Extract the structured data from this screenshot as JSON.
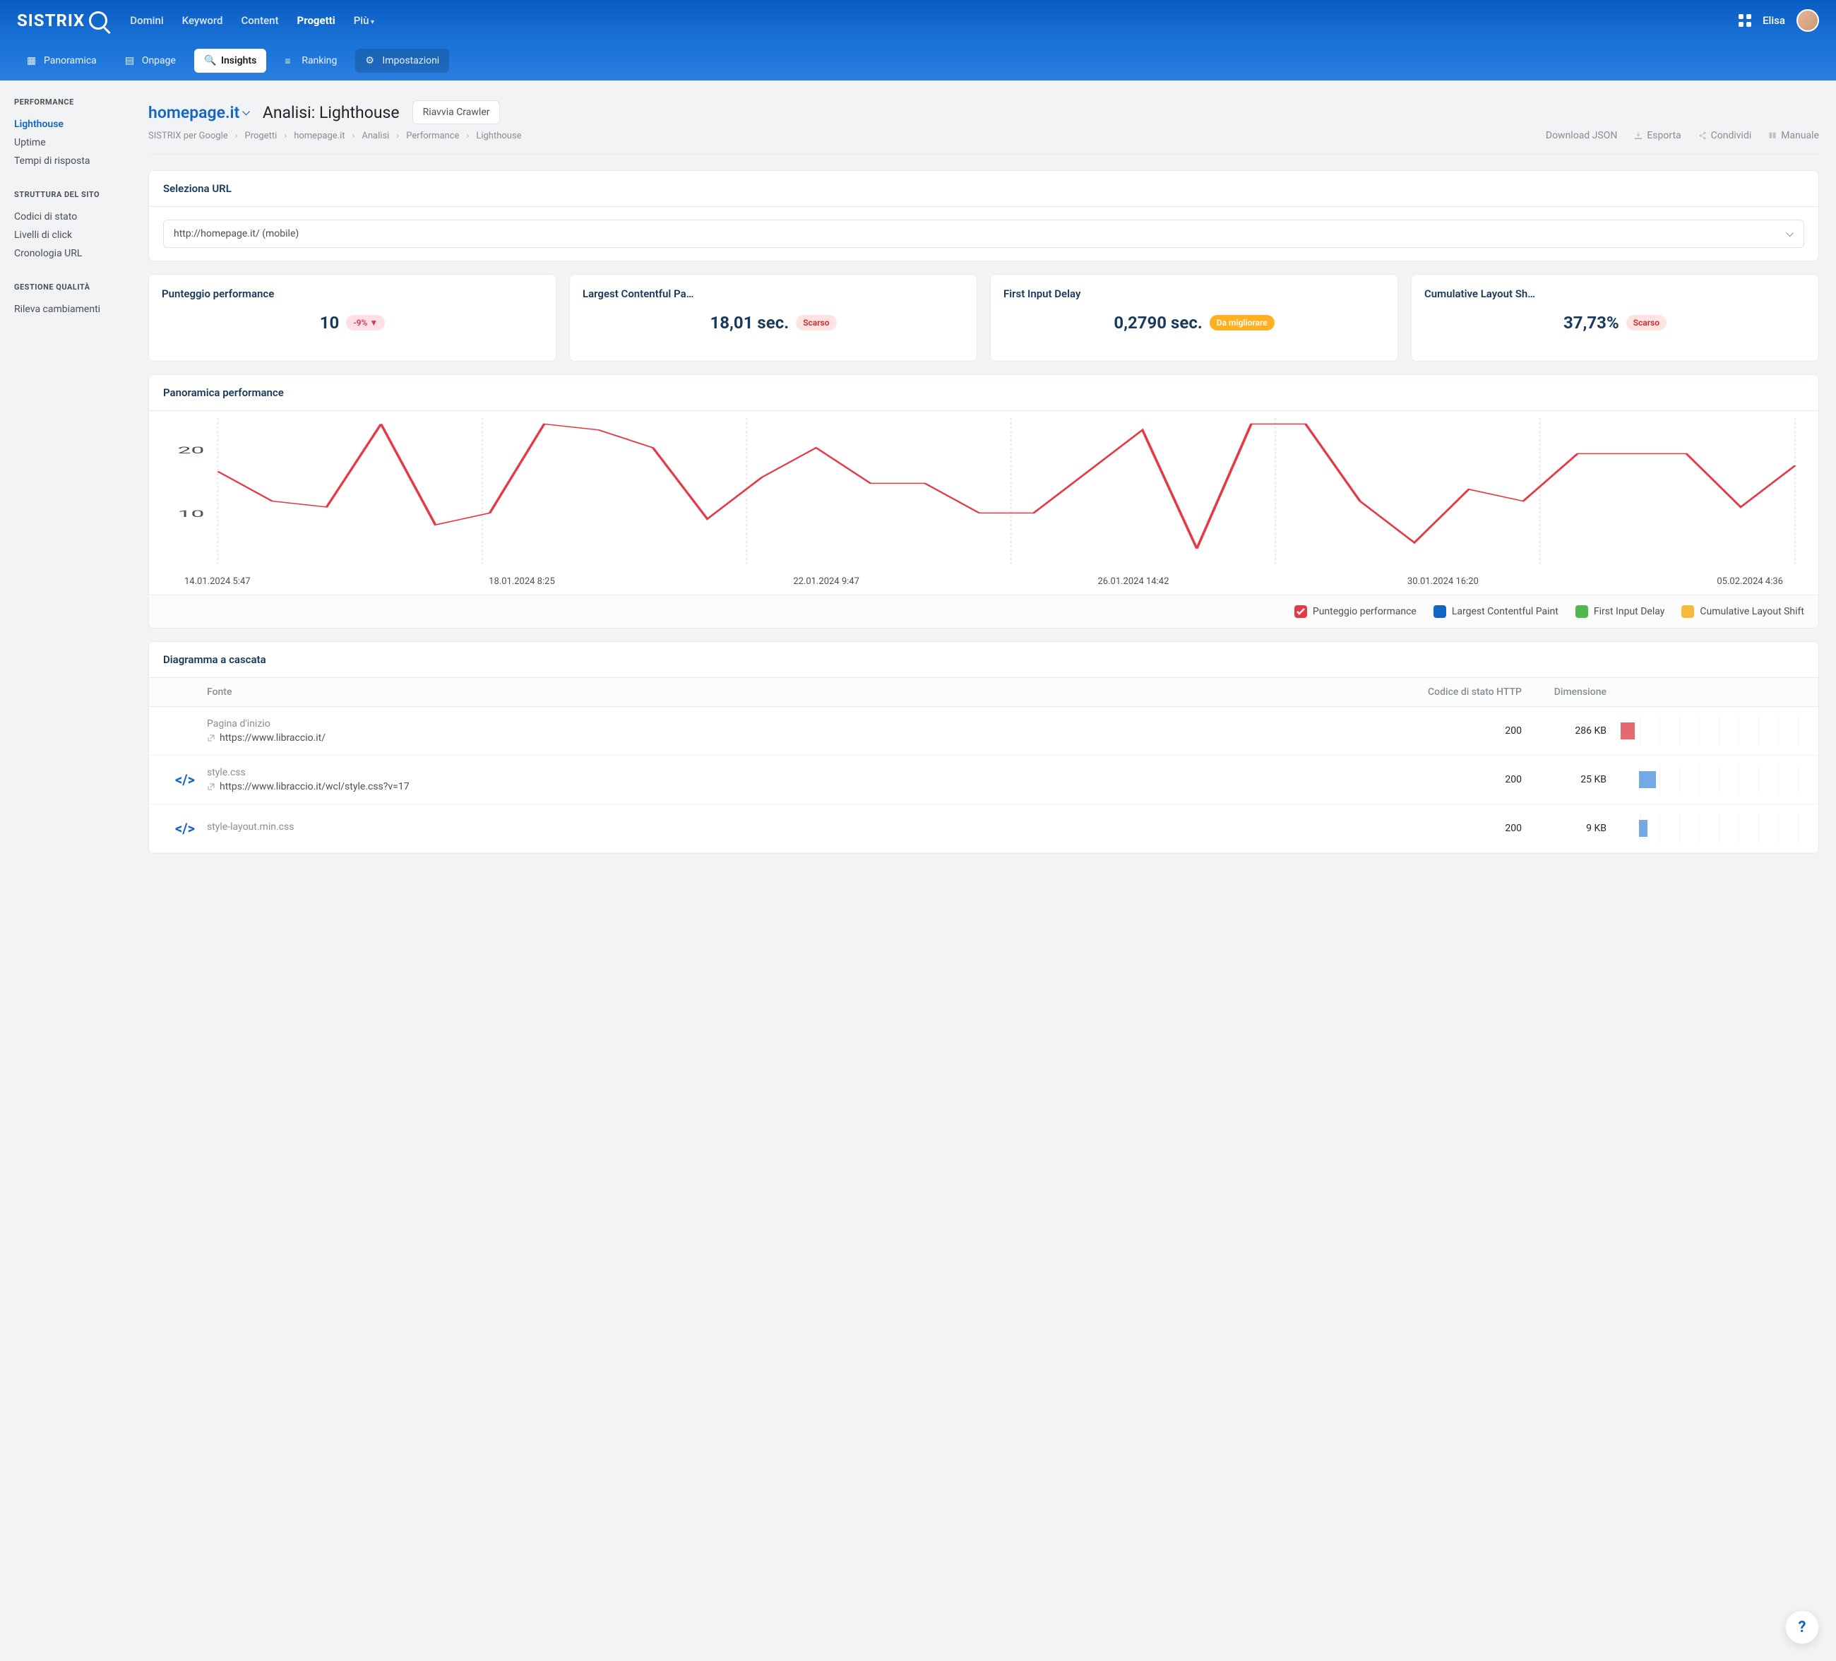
{
  "brand": "SISTRIX",
  "topnav": {
    "links": [
      "Domini",
      "Keyword",
      "Content",
      "Progetti",
      "Più"
    ],
    "active": 3,
    "user": "Elisa"
  },
  "subnav": {
    "items": [
      {
        "label": "Panoramica"
      },
      {
        "label": "Onpage"
      },
      {
        "label": "Insights"
      },
      {
        "label": "Ranking"
      },
      {
        "label": "Impostazioni"
      }
    ],
    "active": 2
  },
  "sidebar": {
    "sections": [
      {
        "heading": "PERFORMANCE",
        "links": [
          "Lighthouse",
          "Uptime",
          "Tempi di risposta"
        ],
        "active": 0
      },
      {
        "heading": "STRUTTURA DEL SITO",
        "links": [
          "Codici di stato",
          "Livelli di click",
          "Cronologia URL"
        ]
      },
      {
        "heading": "GESTIONE QUALITÀ",
        "links": [
          "Rileva cambiamenti"
        ]
      }
    ]
  },
  "header": {
    "domain": "homepage.it",
    "title": "Analisi: Lighthouse",
    "action": "Riavvia Crawler"
  },
  "breadcrumb": [
    "SISTRIX per Google",
    "Progetti",
    "homepage.it",
    "Analisi",
    "Performance",
    "Lighthouse"
  ],
  "pageActions": {
    "download": "Download JSON",
    "export": "Esporta",
    "share": "Condividi",
    "manual": "Manuale"
  },
  "urlSelect": {
    "label": "Seleziona URL",
    "value": "http://homepage.it/ (mobile)"
  },
  "kpis": [
    {
      "title": "Punteggio performance",
      "value": "10",
      "badge": "-9% ▼",
      "badgeClass": "badge-pink"
    },
    {
      "title": "Largest Contentful Pa…",
      "value": "18,01 sec.",
      "badge": "Scarso",
      "badgeClass": "badge-red"
    },
    {
      "title": "First Input Delay",
      "value": "0,2790 sec.",
      "badge": "Da migliorare",
      "badgeClass": "badge-orange"
    },
    {
      "title": "Cumulative Layout Sh…",
      "value": "37,73%",
      "badge": "Scarso",
      "badgeClass": "badge-red"
    }
  ],
  "perfChart": {
    "title": "Panoramica performance",
    "yticks": [
      "20",
      "10"
    ],
    "xlabels": [
      "14.01.2024 5:47",
      "18.01.2024 8:25",
      "22.01.2024 9:47",
      "26.01.2024 14:42",
      "30.01.2024 16:20",
      "05.02.2024 4:36"
    ],
    "legend": [
      {
        "label": "Punteggio performance",
        "color": "#e63946",
        "checked": true
      },
      {
        "label": "Largest Contentful Paint",
        "color": "#1466c3"
      },
      {
        "label": "First Input Delay",
        "color": "#51b84f"
      },
      {
        "label": "Cumulative Layout Shift",
        "color": "#f6b93b"
      }
    ]
  },
  "chart_data": {
    "type": "line",
    "title": "Panoramica performance",
    "ylabel": "",
    "xlabel": "",
    "ylim": [
      0,
      25
    ],
    "x": [
      "14.01.2024 5:47",
      "18.01.2024 8:25",
      "22.01.2024 9:47",
      "26.01.2024 14:42",
      "30.01.2024 16:20",
      "05.02.2024 4:36"
    ],
    "series": [
      {
        "name": "Punteggio performance",
        "values": [
          16,
          11,
          10,
          24,
          7,
          9,
          24,
          23,
          20,
          8,
          15,
          20,
          14,
          14,
          9,
          9,
          16,
          23,
          3,
          24,
          24,
          11,
          4,
          13,
          11,
          19,
          19,
          19,
          10,
          17
        ]
      }
    ]
  },
  "waterfall": {
    "title": "Diagramma a cascata",
    "headers": {
      "source": "Fonte",
      "http": "Codice di stato HTTP",
      "size": "Dimensione"
    },
    "rows": [
      {
        "name": "Pagina d'inizio",
        "url": "https://www.libraccio.it/",
        "http": "200",
        "size": "286 KB",
        "barColor": "#e86870",
        "left": 0,
        "width": 20
      },
      {
        "name": "style.css",
        "url": "https://www.libraccio.it/wcl/style.css?v=17",
        "http": "200",
        "size": "25 KB",
        "barColor": "#74a9e6",
        "left": 26,
        "width": 24,
        "icon": "code"
      },
      {
        "name": "style-layout.min.css",
        "url": "",
        "http": "200",
        "size": "9 KB",
        "barColor": "#74a9e6",
        "left": 26,
        "width": 12,
        "icon": "code"
      }
    ]
  },
  "helpLabel": "?"
}
